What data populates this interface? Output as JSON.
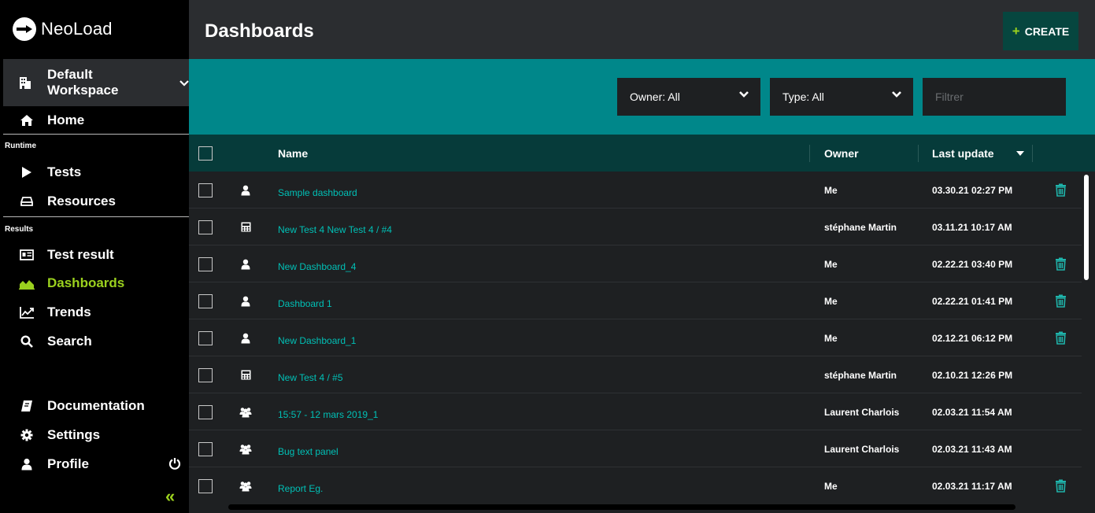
{
  "sidebar": {
    "logo_text": "NeoLoad",
    "workspace": "Default Workspace",
    "items": [
      {
        "label": "Home",
        "icon": "home-icon"
      },
      {
        "label": "Tests",
        "icon": "play-icon"
      },
      {
        "label": "Resources",
        "icon": "drive-icon"
      },
      {
        "label": "Test result",
        "icon": "report-icon"
      },
      {
        "label": "Dashboards",
        "icon": "area-chart-icon"
      },
      {
        "label": "Trends",
        "icon": "trend-line-icon"
      },
      {
        "label": "Search",
        "icon": "search-icon"
      },
      {
        "label": "Documentation",
        "icon": "book-icon"
      },
      {
        "label": "Settings",
        "icon": "gear-icon"
      },
      {
        "label": "Profile",
        "icon": "user-icon"
      }
    ],
    "sections": {
      "runtime": "Runtime",
      "results": "Results"
    },
    "active_item": "Dashboards"
  },
  "header": {
    "title": "Dashboards",
    "create_label": "CREATE"
  },
  "filters": {
    "owner_select": "Owner: All",
    "type_select": "Type: All",
    "filter_placeholder": "Filtrer"
  },
  "table": {
    "columns": {
      "name": "Name",
      "owner": "Owner",
      "last_update": "Last update"
    },
    "rows": [
      {
        "type": "user",
        "name": "Sample dashboard",
        "owner": "Me",
        "date": "03.30.21 02:27 PM",
        "deletable": true
      },
      {
        "type": "test",
        "name": "New Test 4 New Test 4 / #4",
        "owner": "stéphane Martin",
        "date": "03.11.21 10:17 AM",
        "deletable": false
      },
      {
        "type": "user",
        "name": "New Dashboard_4",
        "owner": "Me",
        "date": "02.22.21 03:40 PM",
        "deletable": true
      },
      {
        "type": "user",
        "name": "Dashboard 1",
        "owner": "Me",
        "date": "02.22.21 01:41 PM",
        "deletable": true
      },
      {
        "type": "user",
        "name": "New Dashboard_1",
        "owner": "Me",
        "date": "02.12.21 06:12 PM",
        "deletable": true
      },
      {
        "type": "test",
        "name": "New Test 4 / #5",
        "owner": "stéphane Martin",
        "date": "02.10.21 12:26 PM",
        "deletable": false
      },
      {
        "type": "group",
        "name": "15:57 - 12 mars 2019_1",
        "owner": "Laurent Charlois",
        "date": "02.03.21 11:54 AM",
        "deletable": false
      },
      {
        "type": "group",
        "name": "Bug text panel",
        "owner": "Laurent Charlois",
        "date": "02.03.21 11:43 AM",
        "deletable": false
      },
      {
        "type": "group",
        "name": "Report Eg.",
        "owner": "Me",
        "date": "02.03.21 11:17 AM",
        "deletable": true
      }
    ]
  },
  "colors": {
    "accent_green": "#9bd11e",
    "teal_bar": "#00878a",
    "teal_text": "#00c0b6",
    "header_dark_teal": "#063b3a"
  }
}
